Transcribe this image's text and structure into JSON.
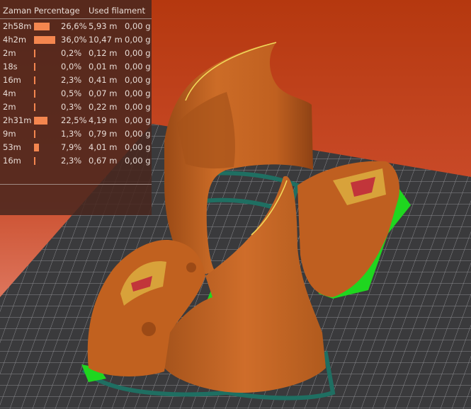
{
  "legend": {
    "headers": {
      "time": "Zaman",
      "percentage": "Percentage",
      "used": "Used filament"
    },
    "rows": [
      {
        "time": "2h58m",
        "pct": "26,6%",
        "pct_value": 26.6,
        "length": "5,93 m",
        "weight": "0,00 g"
      },
      {
        "time": "4h2m",
        "pct": "36,0%",
        "pct_value": 36.0,
        "length": "10,47 m",
        "weight": "0,00 g"
      },
      {
        "time": "2m",
        "pct": "0,2%",
        "pct_value": 0.2,
        "length": "0,12 m",
        "weight": "0,00 g"
      },
      {
        "time": "18s",
        "pct": "0,0%",
        "pct_value": 0.0,
        "length": "0,01 m",
        "weight": "0,00 g"
      },
      {
        "time": "16m",
        "pct": "2,3%",
        "pct_value": 2.3,
        "length": "0,41 m",
        "weight": "0,00 g"
      },
      {
        "time": "4m",
        "pct": "0,5%",
        "pct_value": 0.5,
        "length": "0,07 m",
        "weight": "0,00 g"
      },
      {
        "time": "2m",
        "pct": "0,3%",
        "pct_value": 0.3,
        "length": "0,22 m",
        "weight": "0,00 g"
      },
      {
        "time": "2h31m",
        "pct": "22,5%",
        "pct_value": 22.5,
        "length": "4,19 m",
        "weight": "0,00 g"
      },
      {
        "time": "9m",
        "pct": "1,3%",
        "pct_value": 1.3,
        "length": "0,79 m",
        "weight": "0,00 g"
      },
      {
        "time": "53m",
        "pct": "7,9%",
        "pct_value": 7.9,
        "length": "4,01 m",
        "weight": "0,00 g"
      },
      {
        "time": "16m",
        "pct": "2,3%",
        "pct_value": 2.3,
        "length": "0,67 m",
        "weight": "0,00 g"
      }
    ]
  },
  "colors": {
    "background_top": "#b83a10",
    "background_bottom": "#f0a090",
    "bed": "#3a3a3c",
    "bed_grid": "#9a9a9e",
    "model": "#c4621f",
    "model_dark": "#8a3f12",
    "support": "#1fd61f",
    "skirt": "#1f6f62",
    "legend_bar": "#f4864f"
  }
}
